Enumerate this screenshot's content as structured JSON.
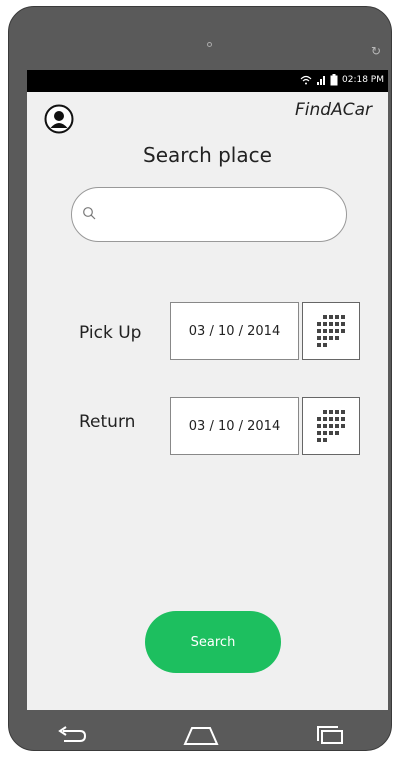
{
  "status_bar": {
    "time": "02:18 PM"
  },
  "header": {
    "app_title": "FindACar"
  },
  "main": {
    "title": "Search place",
    "search": {
      "value": "",
      "placeholder": ""
    },
    "pickup": {
      "label": "Pick Up",
      "date": "03 / 10 / 2014"
    },
    "return": {
      "label": "Return",
      "date": "03 / 10 / 2014"
    },
    "search_button_label": "Search"
  },
  "colors": {
    "accent": "#1dbf5f",
    "screen_bg": "#f0f0f0",
    "device": "#5a5a5a"
  },
  "icons": [
    "user-icon",
    "search-icon",
    "calendar-icon",
    "back-icon",
    "home-icon",
    "recent-apps-icon",
    "wifi-icon",
    "signal-icon",
    "battery-icon"
  ]
}
